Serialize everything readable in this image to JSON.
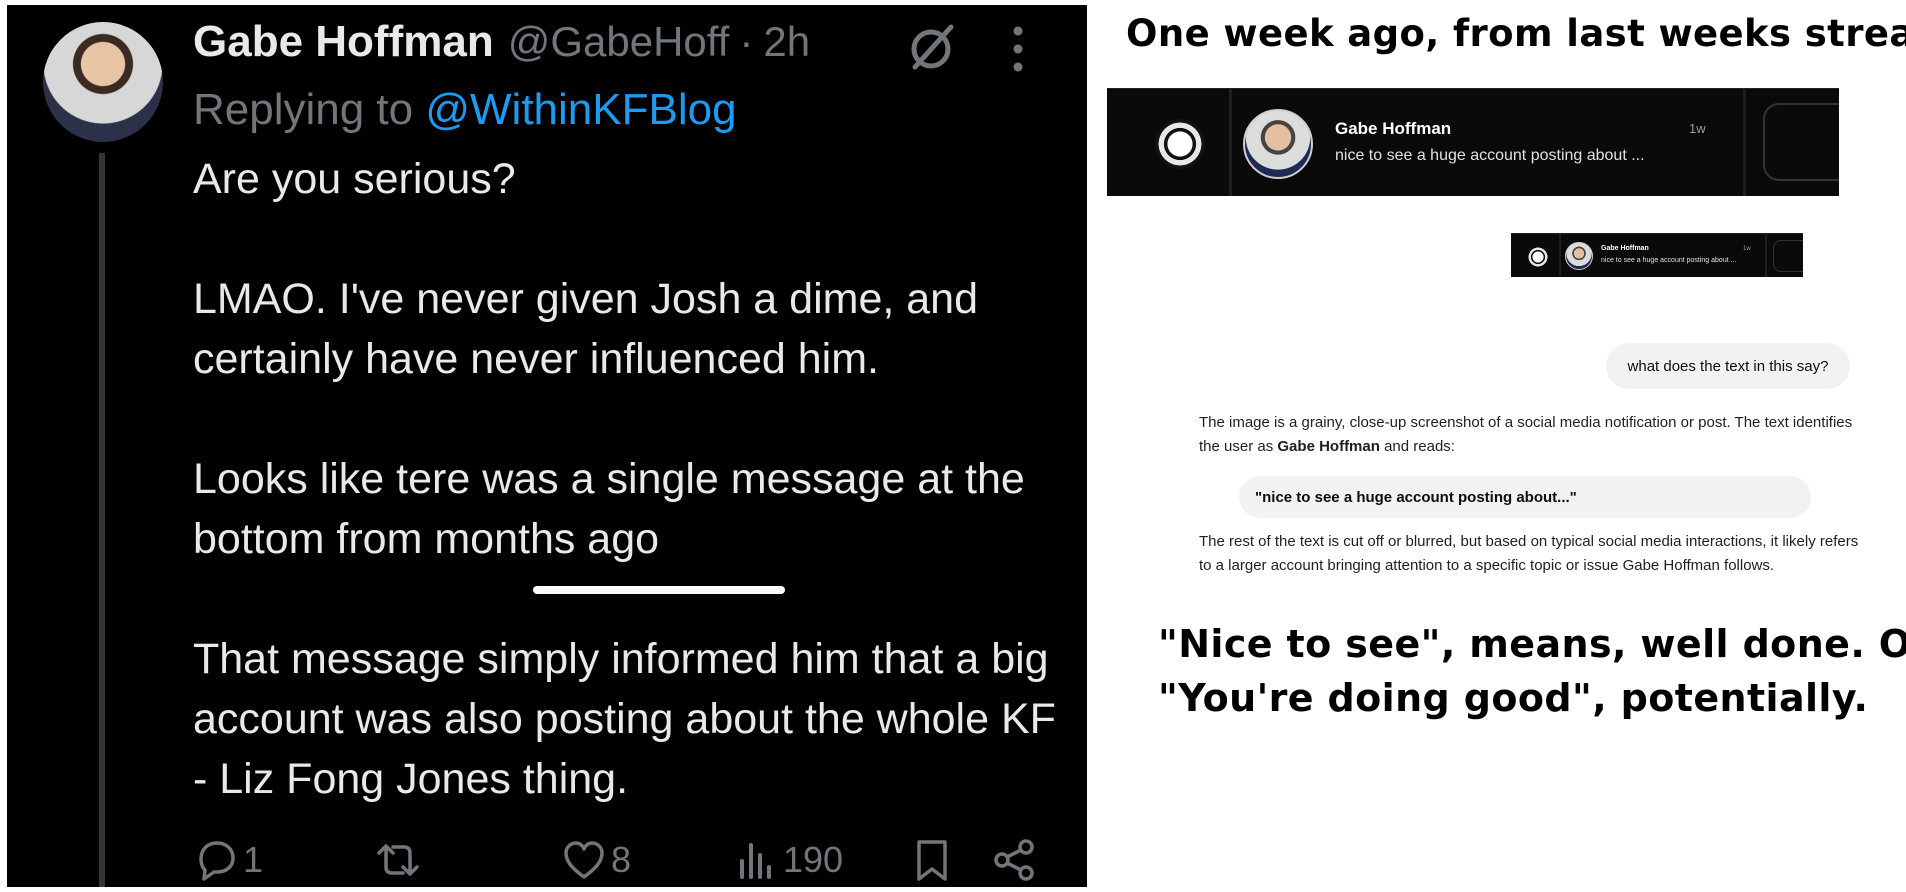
{
  "tweet": {
    "author": "Gabe Hoffman",
    "handle": "@GabeHoff",
    "separator": "·",
    "time": "2h",
    "reply_prefix": "Replying to ",
    "reply_to": "@WithinKFBlog",
    "paragraphs": [
      "Are you serious?",
      "LMAO.  I've never given Josh a dime, and certainly have never influenced him.",
      "Looks like tere was a single message at the bottom from months ago",
      "That message simply informed him that a big account was also posting about the whole KF - Liz Fong Jones thing."
    ],
    "stats": {
      "replies": "1",
      "likes": "8",
      "views": "190"
    },
    "icons": [
      "grok-icon",
      "more-icon",
      "reply-icon",
      "retweet-icon",
      "like-icon",
      "views-icon",
      "bookmark-icon",
      "share-icon"
    ]
  },
  "commentary": {
    "top_caption": "One week ago, from last weeks stream.",
    "bottom_caption_lines": [
      "\"Nice to see\", means, well done. Or,",
      "\"You're doing good\", potentially."
    ]
  },
  "notification": {
    "name": "Gabe Hoffman",
    "time": "1w",
    "preview": "nice to see a huge account posting about ..."
  },
  "chat": {
    "user_message": "what does the text in this say?",
    "ai_intro": "The image is a grainy, close-up screenshot of a social media notification or post. The text identifies the user as ",
    "ai_name": "Gabe Hoffman",
    "ai_intro_end": " and reads:",
    "ai_quote": "\"nice to see a huge account posting about...\"",
    "ai_followup": "The rest of the text is cut off or blurred, but based on typical social media interactions, it likely refers to a larger account bringing attention to a specific topic or issue Gabe Hoffman follows."
  }
}
